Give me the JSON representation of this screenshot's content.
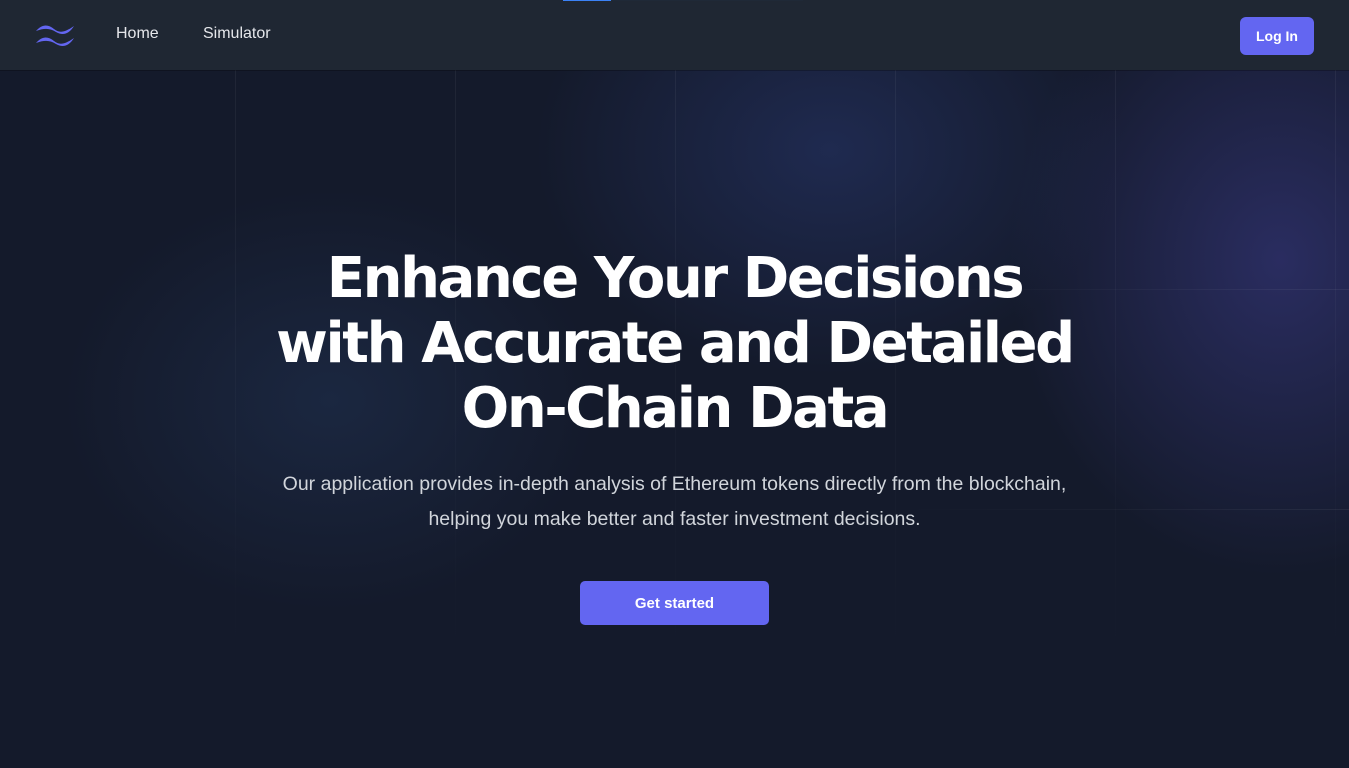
{
  "nav": {
    "logo_icon": "tailwind-wave-logo-icon",
    "links": [
      {
        "label": "Home"
      },
      {
        "label": "Simulator"
      }
    ],
    "login_label": "Log In"
  },
  "hero": {
    "title_lines": [
      "Enhance Your Decisions",
      "with Accurate and Detailed",
      "On-Chain Data"
    ],
    "subtitle_lines": [
      "Our application provides in-depth analysis of Ethereum tokens directly from the blockchain,",
      "helping you make better and faster investment decisions."
    ],
    "cta_label": "Get started"
  },
  "colors": {
    "accent": "#6366f1",
    "nav_background": "#1f2733",
    "page_background": "#111827",
    "text_primary": "#ffffff",
    "text_secondary": "#d1d5db"
  }
}
